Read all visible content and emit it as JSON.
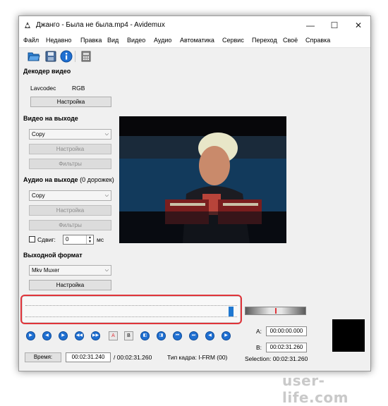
{
  "window": {
    "title": "Джанго - Была не была.mp4 - Avidemux",
    "minimize": "—",
    "maximize": "☐",
    "close": "✕"
  },
  "menu": [
    "Файл",
    "Недавно",
    "Правка",
    "Вид",
    "Видео",
    "Аудио",
    "Автоматика",
    "Сервис",
    "Переход",
    "Своё",
    "Справка"
  ],
  "decoder": {
    "title": "Декодер видео",
    "codec": "Lavcodec",
    "colorspace": "RGB",
    "settings_button": "Настройка"
  },
  "video_output": {
    "title": "Видео на выходе",
    "selected": "Copy",
    "settings_button": "Настройка",
    "filters_button": "Фильтры"
  },
  "audio_output": {
    "title": "Аудио на выходе",
    "tracks": "(0 дорожек)",
    "selected": "Copy",
    "settings_button": "Настройка",
    "filters_button": "Фильтры",
    "shift_label": "Сдвиг:",
    "shift_value": "0",
    "shift_unit": "мс"
  },
  "output_format": {
    "title": "Выходной формат",
    "selected": "Mkv Muxer",
    "settings_button": "Настройка"
  },
  "status": {
    "time_button": "Время:",
    "current_time": "00:02:31.240",
    "total_time": "/ 00:02:31.260",
    "frame_type": "Тип кадра:  I-FRM (00)",
    "a_label": "A:",
    "a_value": "00:00:00.000",
    "b_label": "B:",
    "b_value": "00:02:31.260",
    "selection": "Selection: 00:02:31.260"
  },
  "transport": {
    "marker_a": "A",
    "marker_b": "B"
  },
  "playback_position": 0.99,
  "watermark": "user-life.com",
  "colors": {
    "accent": "#1f78d1",
    "highlight": "#e0343a"
  }
}
